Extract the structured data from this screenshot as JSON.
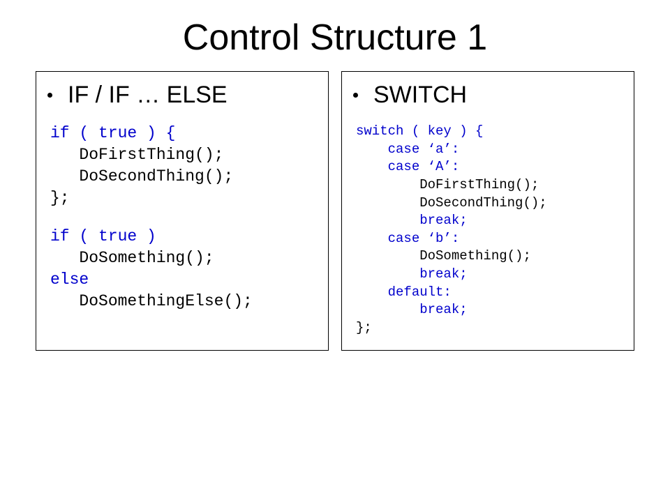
{
  "title": "Control Structure 1",
  "left": {
    "heading": "IF / IF … ELSE",
    "lines": [
      {
        "cls": "kw",
        "ind": 0,
        "text": "if ( true ) {"
      },
      {
        "cls": "",
        "ind": 1,
        "text": "DoFirstThing();"
      },
      {
        "cls": "",
        "ind": 1,
        "text": "DoSecondThing();"
      },
      {
        "cls": "",
        "ind": 0,
        "text": "};"
      },
      {
        "cls": "gap",
        "ind": 0,
        "text": ""
      },
      {
        "cls": "kw",
        "ind": 0,
        "text": "if ( true )"
      },
      {
        "cls": "",
        "ind": 1,
        "text": "DoSomething();"
      },
      {
        "cls": "kw",
        "ind": 0,
        "text": "else"
      },
      {
        "cls": "",
        "ind": 1,
        "text": "DoSomethingElse();"
      }
    ]
  },
  "right": {
    "heading": "SWITCH",
    "lines": [
      {
        "cls": "kw",
        "ind": 0,
        "text": "switch ( key ) {"
      },
      {
        "cls": "kw",
        "ind": 1,
        "text": "case ‘a’:"
      },
      {
        "cls": "kw",
        "ind": 1,
        "text": "case ‘A’:"
      },
      {
        "cls": "",
        "ind": 2,
        "text": "DoFirstThing();"
      },
      {
        "cls": "",
        "ind": 2,
        "text": "DoSecondThing();"
      },
      {
        "cls": "kw",
        "ind": 2,
        "text": "break;"
      },
      {
        "cls": "kw",
        "ind": 1,
        "text": "case ‘b’:"
      },
      {
        "cls": "",
        "ind": 2,
        "text": "DoSomething();"
      },
      {
        "cls": "kw",
        "ind": 2,
        "text": "break;"
      },
      {
        "cls": "kw",
        "ind": 1,
        "text": "default:"
      },
      {
        "cls": "kw",
        "ind": 2,
        "text": "break;"
      },
      {
        "cls": "",
        "ind": 0,
        "text": "};"
      }
    ]
  }
}
